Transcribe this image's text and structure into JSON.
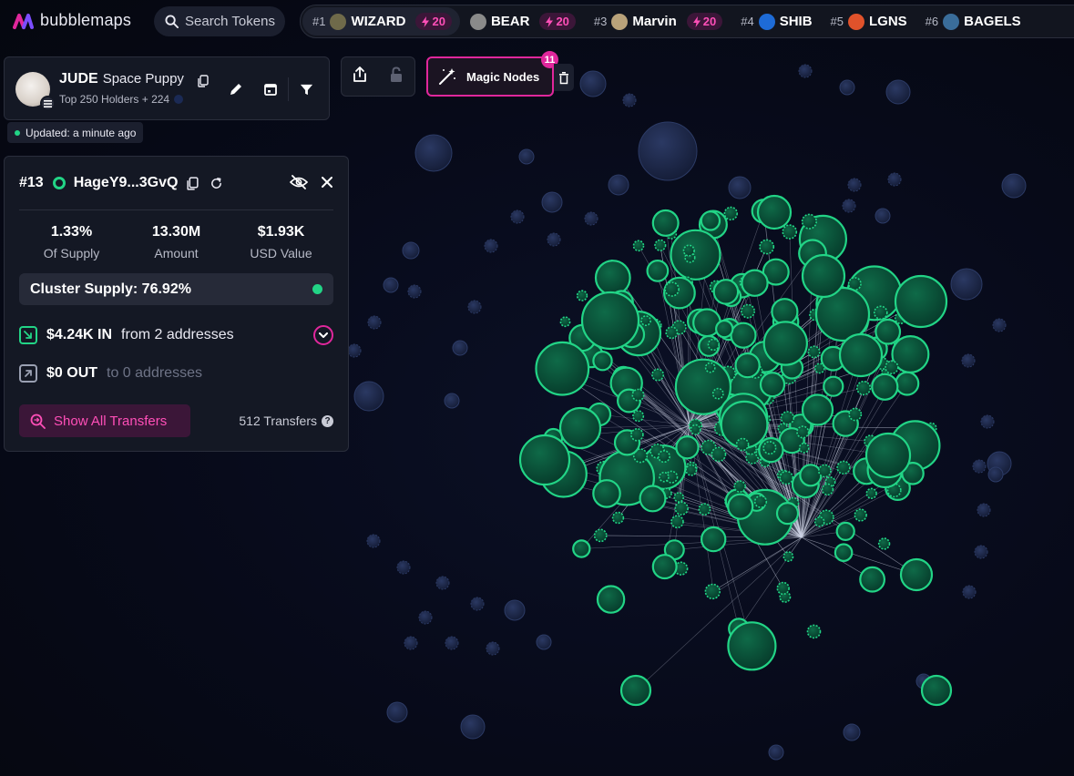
{
  "app": {
    "name": "bubblemaps"
  },
  "search": {
    "label": "Search Tokens"
  },
  "trending": [
    {
      "rank": "#1",
      "name": "WIZARD",
      "boost": "20",
      "avatar_color": "#6f6a4a"
    },
    {
      "rank": "",
      "name": "BEAR",
      "boost": "20",
      "avatar_color": "#8a8a8a"
    },
    {
      "rank": "#3",
      "name": "Marvin",
      "boost": "20",
      "avatar_color": "#b9a27a"
    },
    {
      "rank": "#4",
      "name": "SHIB",
      "boost": "",
      "avatar_color": "#1e6bd6"
    },
    {
      "rank": "#5",
      "name": "LGNS",
      "boost": "",
      "avatar_color": "#e0522b"
    },
    {
      "rank": "#6",
      "name": "BAGELS",
      "boost": "",
      "avatar_color": "#3a6d9a"
    }
  ],
  "token": {
    "symbol": "JUDE",
    "name": "Space Puppy",
    "subtitle": "Top 250 Holders + 224"
  },
  "status": {
    "updated": "Updated: a minute ago"
  },
  "magic_nodes": {
    "label": "Magic Nodes",
    "count": "11"
  },
  "holder": {
    "rank": "#13",
    "address": "HageY9...3GvQ",
    "stats": [
      {
        "value": "1.33%",
        "label": "Of Supply"
      },
      {
        "value": "13.30M",
        "label": "Amount"
      },
      {
        "value": "$1.93K",
        "label": "USD Value"
      }
    ],
    "cluster_supply": "Cluster Supply: 76.92%",
    "in": {
      "amount": "$4.24K IN",
      "desc": "from 2 addresses"
    },
    "out": {
      "amount": "$0 OUT",
      "desc": "to 0 addresses"
    },
    "show_transfers": "Show All Transfers",
    "transfers_count": "512 Transfers"
  },
  "colors": {
    "accent": "#e0279c",
    "cluster_green": "#22d486",
    "bubble_dark": "#1c2746",
    "panel": "#141824"
  }
}
